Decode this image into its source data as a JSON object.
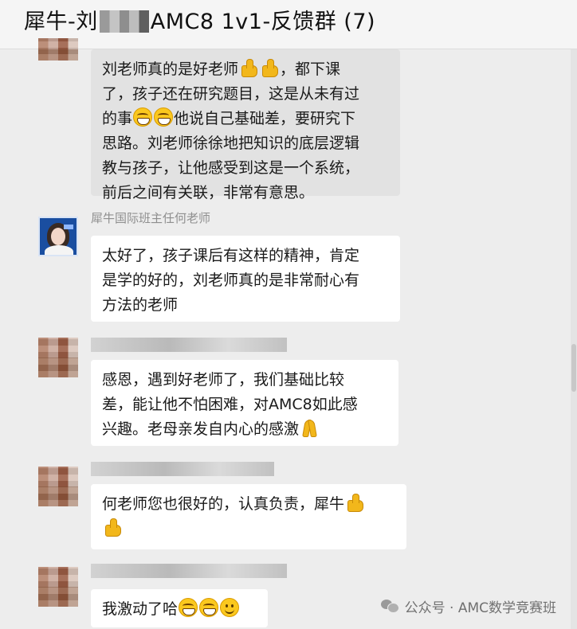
{
  "header": {
    "title_prefix": "犀牛-刘",
    "title_suffix": "AMC8 1v1-反馈群 (7)"
  },
  "messages": [
    {
      "sender": "",
      "lines": [
        "刘老师真的是好老师",
        "，都下课",
        "了，孩子还在研究题目，这是从未有过",
        "的事",
        "他说自己基础差，要研究下",
        "思路。刘老师徐徐地把知识的底层逻辑",
        "教与孩子，让他感受到这是一个系统，",
        "前后之间有关联，非常有意思。"
      ]
    },
    {
      "sender": "犀牛国际班主任何老师",
      "lines": [
        "太好了，孩子课后有这样的精神，肯定",
        "是学的好的，刘老师真的是非常耐心有",
        "方法的老师"
      ]
    },
    {
      "sender": "",
      "lines": [
        "感恩，遇到好老师了，我们基础比较",
        "差，能让他不怕困难，对AMC8如此感",
        "兴趣。老母亲发自内心的感激"
      ]
    },
    {
      "sender": "",
      "lines": [
        "何老师您也很好的，认真负责，犀牛"
      ]
    },
    {
      "sender": "",
      "lines": [
        "我激动了哈"
      ]
    }
  ],
  "emoji": {
    "thumbs_up": "thumbs-up-icon",
    "grin": "grinning-face-icon",
    "smile": "smiling-face-icon",
    "pray": "folded-hands-icon"
  },
  "watermark": {
    "text": "公众号 · AMC数学竞赛班"
  },
  "colors": {
    "background": "#ededed",
    "bubble_self": "#e2e2e2",
    "bubble_other": "#ffffff",
    "sender_name": "#8f8f8f"
  }
}
